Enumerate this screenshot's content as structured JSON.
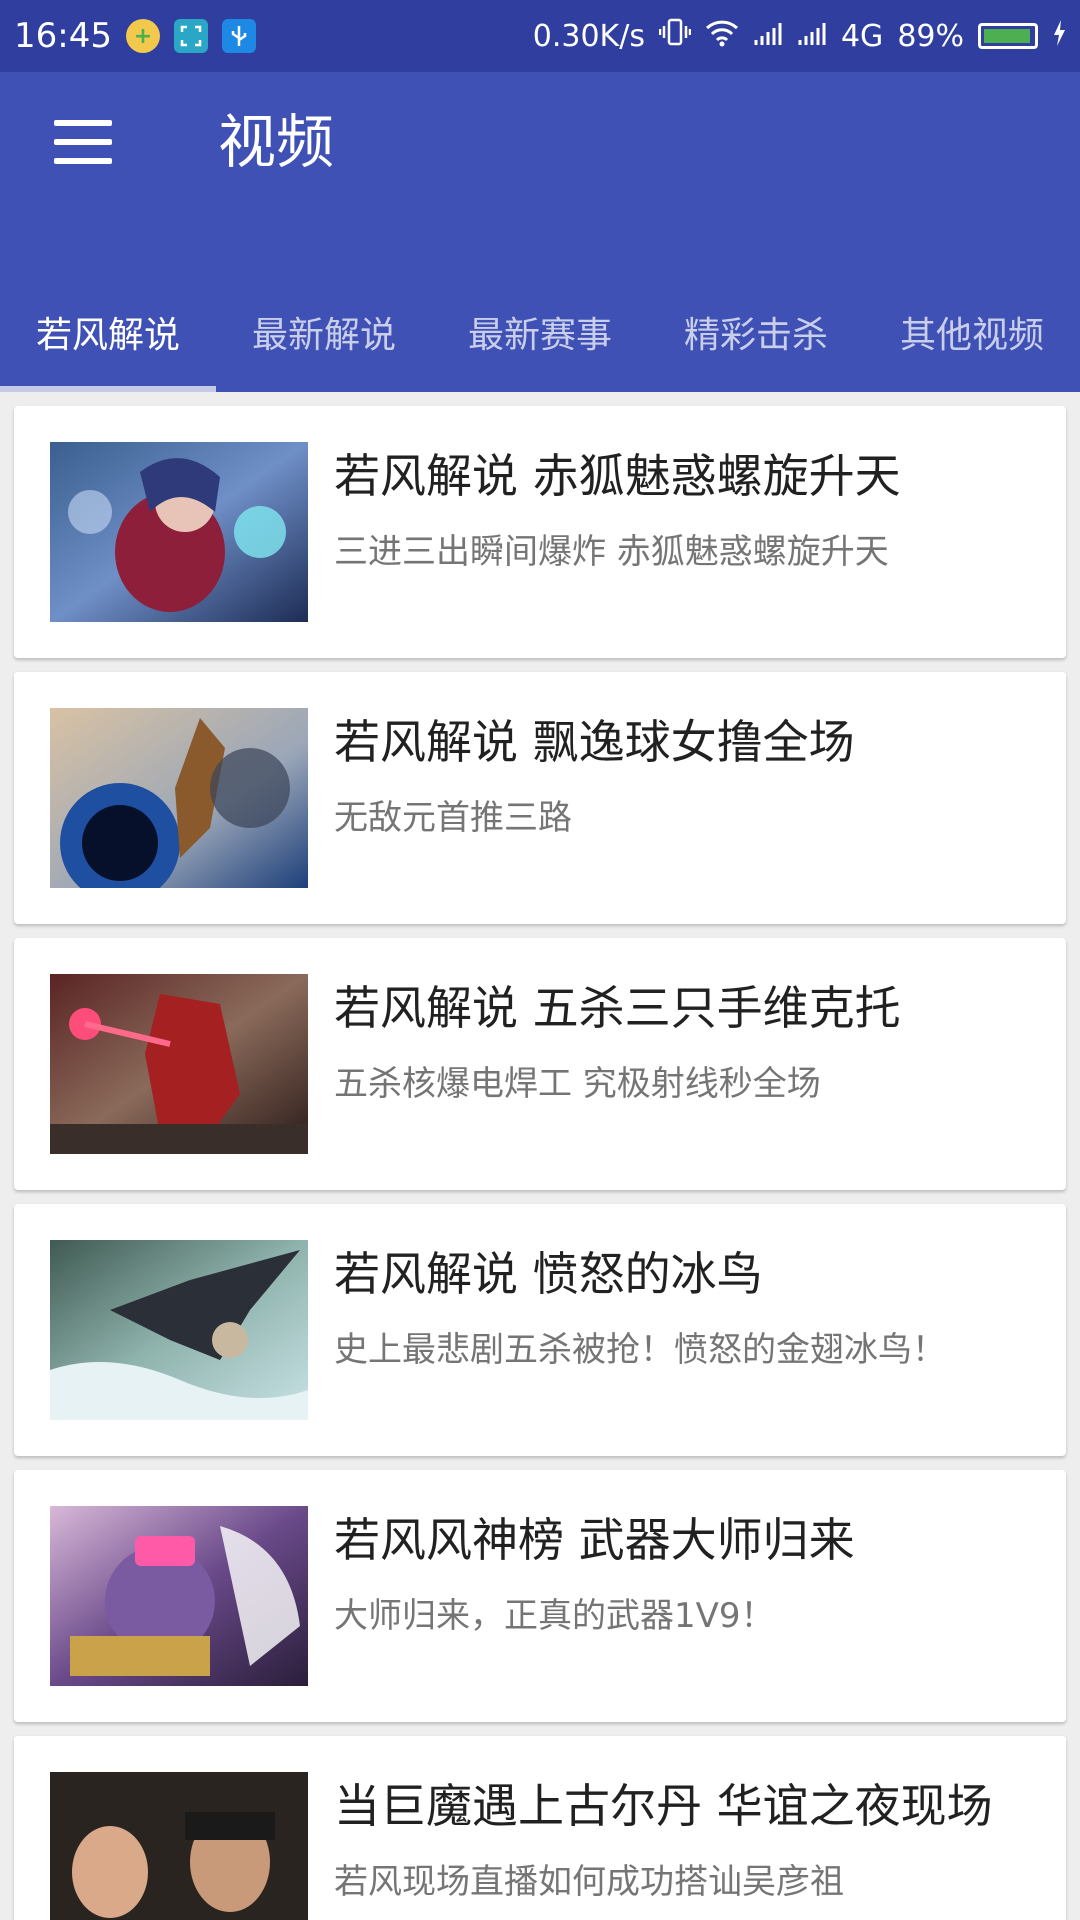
{
  "status_bar": {
    "time": "16:45",
    "speed": "0.30K/s",
    "network": "4G",
    "battery": "89%",
    "battery_level": 0.89,
    "icons": [
      "plus-circle-icon",
      "scan-icon",
      "usb-icon",
      "vibrate-icon",
      "wifi-icon",
      "signal-icon",
      "signal-icon",
      "charging-icon"
    ]
  },
  "app_bar": {
    "title": "视频",
    "menu_icon": "hamburger-menu-icon"
  },
  "tabs": [
    {
      "label": "若风解说",
      "active": true
    },
    {
      "label": "最新解说",
      "active": false
    },
    {
      "label": "最新赛事",
      "active": false
    },
    {
      "label": "精彩击杀",
      "active": false
    },
    {
      "label": "其他视频",
      "active": false
    }
  ],
  "videos": [
    {
      "title": "若风解说 赤狐魅惑螺旋升天",
      "subtitle": "三进三出瞬间爆炸  赤狐魅惑螺旋升天"
    },
    {
      "title": "若风解说 飘逸球女撸全场",
      "subtitle": "无敌元首推三路"
    },
    {
      "title": "若风解说 五杀三只手维克托",
      "subtitle": "五杀核爆电焊工  究极射线秒全场"
    },
    {
      "title": "若风解说 愤怒的冰鸟",
      "subtitle": "史上最悲剧五杀被抢！愤怒的金翅冰鸟！"
    },
    {
      "title": "若风风神榜 武器大师归来",
      "subtitle": "大师归来，正真的武器1V9！"
    },
    {
      "title": "当巨魔遇上古尔丹 华谊之夜现场",
      "subtitle": "若风现场直播如何成功搭讪吴彦祖"
    }
  ],
  "colors": {
    "status_bar": "#303f9f",
    "app_bar": "#3f51b5",
    "indicator": "#c5cae9"
  }
}
